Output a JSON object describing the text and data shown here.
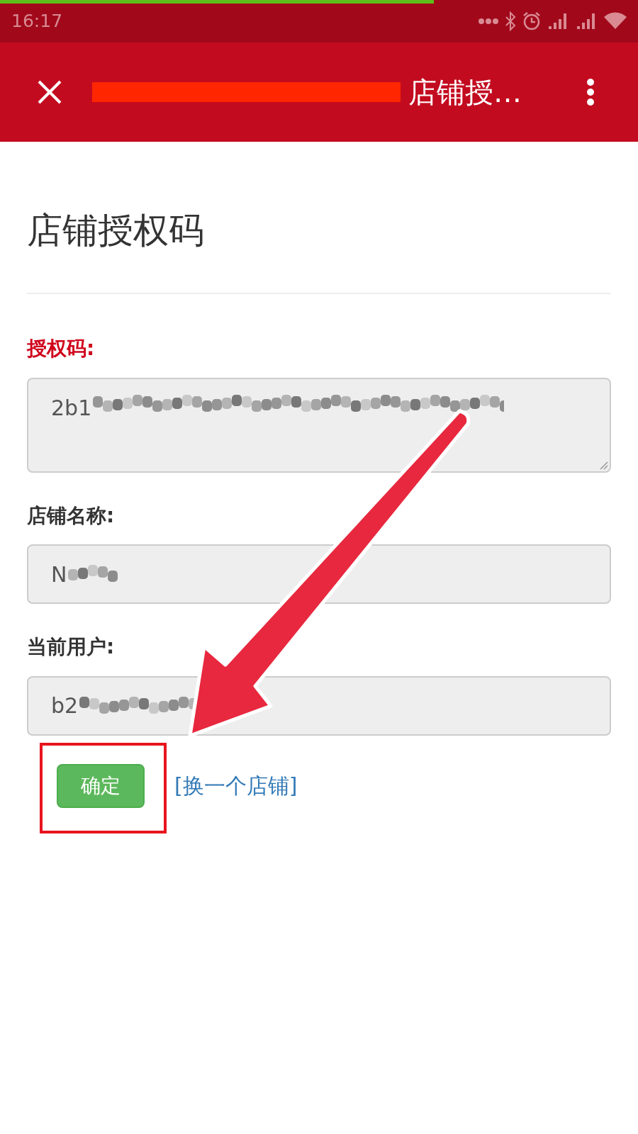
{
  "status_bar": {
    "time": "16:17",
    "load_progress": {
      "level": 0.68
    }
  },
  "header": {
    "title": "店铺授…",
    "redacted": true
  },
  "form": {
    "heading": "店铺授权码",
    "fields": [
      {
        "label": "授权码:",
        "kind": "textarea",
        "value": "2b1",
        "error": true
      },
      {
        "label": "店铺名称:",
        "kind": "input",
        "value": "N",
        "error": false
      },
      {
        "label": "当前用户:",
        "kind": "input",
        "value": "b2",
        "error": false
      }
    ],
    "submit": "确定",
    "switch_link": "[换一个店铺]"
  },
  "annotations": {
    "arrow": true,
    "highlight_box": true
  }
}
